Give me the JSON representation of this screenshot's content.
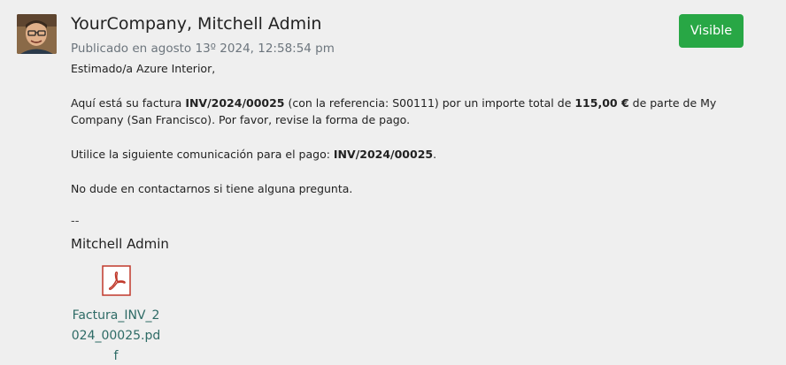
{
  "message": {
    "author": "YourCompany, Mitchell Admin",
    "date": "Publicado en agosto 13º 2024, 12:58:54 pm",
    "visibility_button": "Visible",
    "greeting": "Estimado/a Azure Interior,",
    "para1": {
      "t1": "Aquí está su factura ",
      "invoice": "INV/2024/00025",
      "t2": " (con la referencia: S00111) por un importe total de ",
      "amount": "115,00 €",
      "t3": " de parte de My Company (San Francisco). Por favor, revise la forma de pago."
    },
    "para2": {
      "t1": "Utilice la siguiente comunicación para el pago: ",
      "ref": "INV/2024/00025",
      "t2": "."
    },
    "para3": "No dude en contactarnos si tiene alguna pregunta.",
    "signature_dash": "--",
    "signature_name": "Mitchell Admin"
  },
  "attachment": {
    "icon": "pdf-icon",
    "filename": "Factura_INV_2024_00025.pdf"
  },
  "colors": {
    "visible_button": "#28a745",
    "attachment_link": "#2e6b66",
    "pdf_icon": "#c0392b"
  }
}
